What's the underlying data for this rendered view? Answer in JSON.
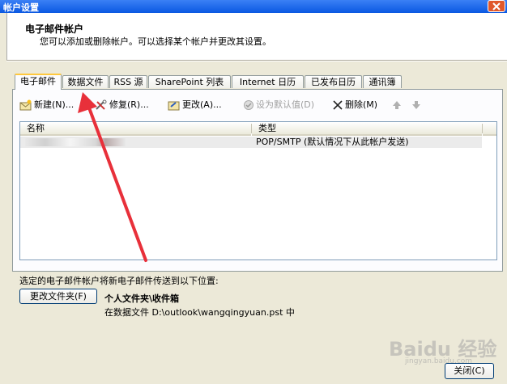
{
  "window": {
    "title": "帐户设置"
  },
  "header": {
    "title": "电子邮件帐户",
    "subtitle": "您可以添加或删除帐户。可以选择某个帐户并更改其设置。"
  },
  "tabs": [
    {
      "label": "电子邮件",
      "active": true
    },
    {
      "label": "数据文件"
    },
    {
      "label": "RSS 源"
    },
    {
      "label": "SharePoint 列表"
    },
    {
      "label": "Internet 日历"
    },
    {
      "label": "已发布日历"
    },
    {
      "label": "通讯簿"
    }
  ],
  "toolbar": {
    "new": "新建(N)...",
    "repair": "修复(R)...",
    "change": "更改(A)...",
    "set_default": "设为默认值(D)",
    "remove": "删除(M)"
  },
  "list": {
    "col_name": "名称",
    "col_type": "类型",
    "rows": [
      {
        "type": "POP/SMTP (默认情况下从此帐户发送)"
      }
    ]
  },
  "delivery": {
    "label": "选定的电子邮件帐户将新电子邮件传送到以下位置:",
    "change_folder_button": "更改文件夹(F)",
    "folder": "个人文件夹\\收件箱",
    "path": "在数据文件 D:\\outlook\\wangqingyuan.pst 中"
  },
  "footer": {
    "close": "关闭(C)"
  },
  "watermark": {
    "brand": "Baidu 经验",
    "url": "jingyan.baidu.com"
  },
  "colors": {
    "annotation_arrow": "#e8303a",
    "titlebar": "#0a58e2"
  }
}
